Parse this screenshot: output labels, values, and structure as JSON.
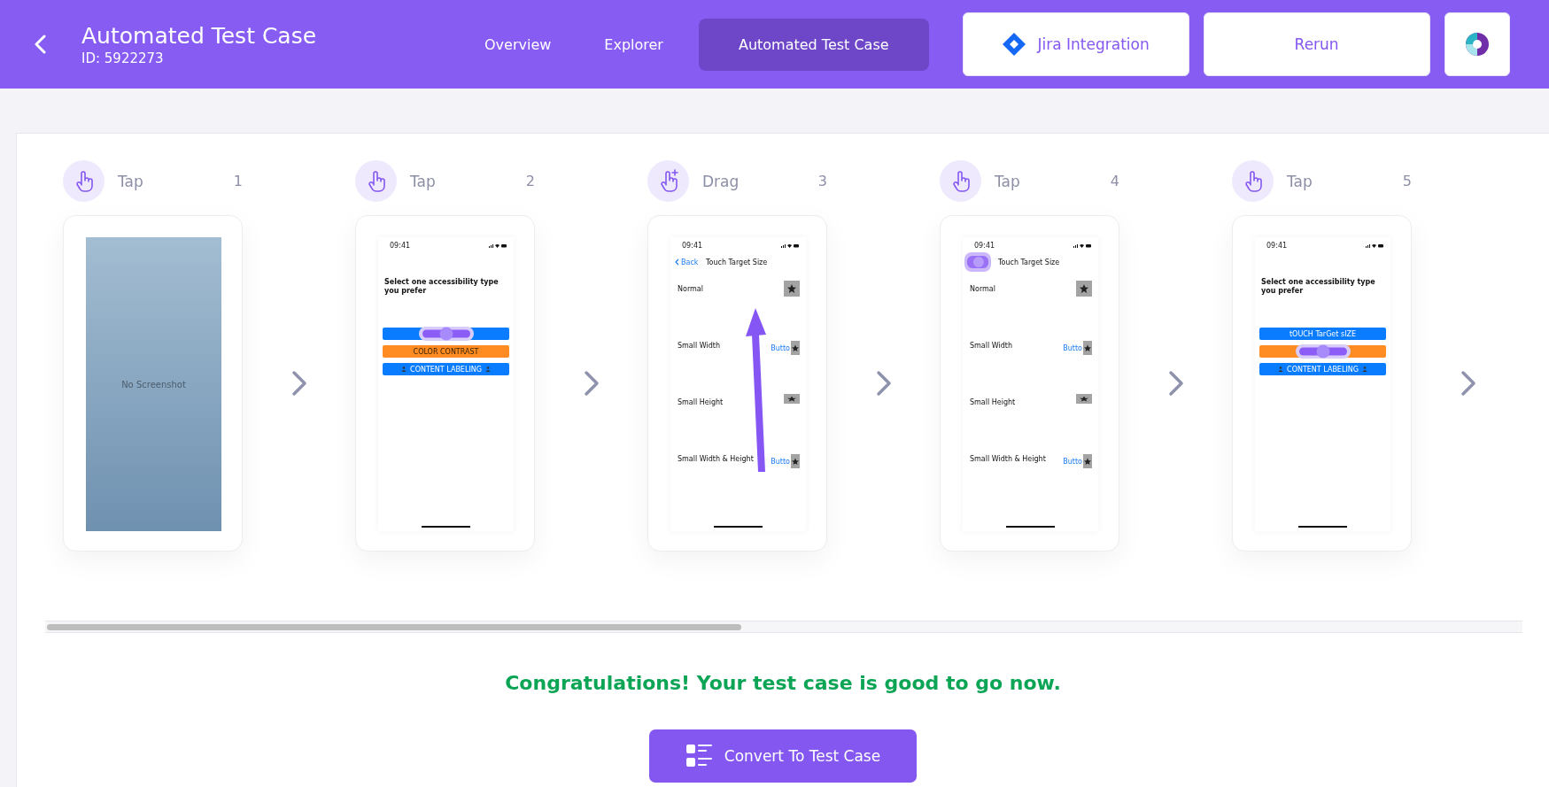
{
  "header": {
    "title": "Automated Test Case",
    "id_label": "ID: 5922273"
  },
  "tabs": [
    {
      "label": "Overview",
      "selected": false
    },
    {
      "label": "Explorer",
      "selected": false
    },
    {
      "label": "Automated Test Case",
      "selected": true
    }
  ],
  "actions": [
    {
      "kind": "jira",
      "label": "Jira Integration"
    },
    {
      "kind": "plain",
      "label": "Rerun"
    },
    {
      "kind": "logo"
    }
  ],
  "steps": [
    {
      "action": "Tap",
      "kind": "tap",
      "number": "1",
      "screen": {
        "kind": "none",
        "label": "No Screenshot"
      }
    },
    {
      "action": "Tap",
      "kind": "tap",
      "number": "2",
      "screen": {
        "kind": "choices",
        "time": "09:41",
        "heading": "Select one accessibility type you prefer",
        "buttons": [
          {
            "color": "#0a7cff",
            "touched": true,
            "side_icons": false
          },
          {
            "label": "COLOR CONTRAST",
            "color": "#ff8c22",
            "touched": false,
            "side_icons": false
          },
          {
            "label": "CONTENT LABELING",
            "color": "#0a7cff",
            "touched": false,
            "side_icons": true
          }
        ]
      }
    },
    {
      "action": "Drag",
      "kind": "drag",
      "number": "3",
      "screen": {
        "kind": "list",
        "time": "09:41",
        "back": {
          "label": "Back",
          "touched": false
        },
        "title": "Touch Target Size",
        "drag": true,
        "rows": [
          {
            "label": "Normal",
            "kind": "star"
          },
          {
            "label": "Small Width",
            "kind": "button_star",
            "button_label": "Butto"
          },
          {
            "label": "Small Height",
            "kind": "star"
          },
          {
            "label": "Small Width & Height",
            "kind": "button_star",
            "button_label": "Butto"
          }
        ]
      }
    },
    {
      "action": "Tap",
      "kind": "tap",
      "number": "4",
      "screen": {
        "kind": "list",
        "time": "09:41",
        "back": {
          "touched": true
        },
        "title": "Touch Target Size",
        "drag": false,
        "rows": [
          {
            "label": "Normal",
            "kind": "star"
          },
          {
            "label": "Small Width",
            "kind": "button_star",
            "button_label": "Butto"
          },
          {
            "label": "Small Height",
            "kind": "star"
          },
          {
            "label": "Small Width & Height",
            "kind": "button_star",
            "button_label": "Butto"
          }
        ]
      }
    },
    {
      "action": "Tap",
      "kind": "tap",
      "number": "5",
      "screen": {
        "kind": "choices",
        "time": "09:41",
        "heading": "Select one accessibility type you prefer",
        "buttons": [
          {
            "label": "tOUCH TarGet sIZE",
            "color": "#0a7cff",
            "touched": false,
            "side_icons": false
          },
          {
            "color": "#ff8c22",
            "touched": true,
            "side_icons": false
          },
          {
            "label": "CONTENT LABELING",
            "color": "#0a7cff",
            "touched": false,
            "side_icons": true
          }
        ]
      }
    }
  ],
  "congrats": "Congratulations! Your test case is good to go now.",
  "convert_button": "Convert To Test Case"
}
